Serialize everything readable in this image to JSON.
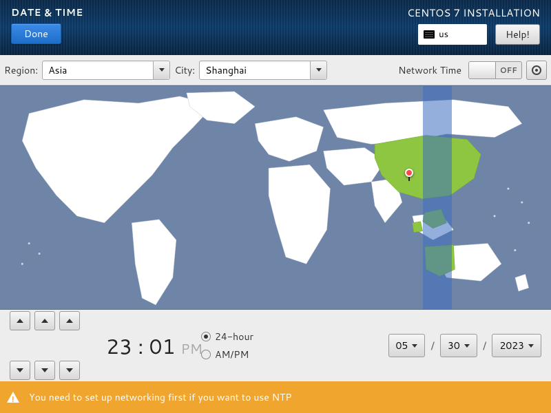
{
  "header": {
    "title": "DATE & TIME",
    "done_label": "Done",
    "install_title": "CENTOS 7 INSTALLATION",
    "keyboard_layout": "us",
    "help_label": "Help!"
  },
  "controls": {
    "region_label": "Region:",
    "region_value": "Asia",
    "city_label": "City:",
    "city_value": "Shanghai",
    "network_time_label": "Network Time",
    "network_time_state": "OFF"
  },
  "map": {
    "selected_timezone": "Asia/Shanghai",
    "pin_location": "Shanghai"
  },
  "time": {
    "hours": "23",
    "minutes": "01",
    "ampm": "PM",
    "format_24h_label": "24-hour",
    "format_ampm_label": "AM/PM",
    "format_selected": "24-hour"
  },
  "date": {
    "month": "05",
    "day": "30",
    "year": "2023"
  },
  "warning": {
    "message": "You need to set up networking first if you want to use NTP"
  },
  "colors": {
    "header_bg": "#0d3b6a",
    "accent_blue": "#1e6fc9",
    "map_bg": "#6f85a8",
    "highlight_green": "#8bc34a",
    "warning_bg": "#f0a52f"
  }
}
